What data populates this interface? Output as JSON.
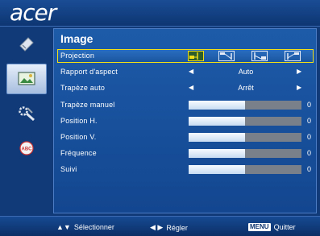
{
  "brand": "acer",
  "sidebar": [
    {
      "name": "color-tool-icon",
      "active": false
    },
    {
      "name": "image-icon",
      "active": true
    },
    {
      "name": "settings-icon",
      "active": false
    },
    {
      "name": "language-icon",
      "active": false,
      "text": "ABC"
    }
  ],
  "panel": {
    "title": "Image",
    "rows": [
      {
        "label": "Projection",
        "kind": "icons",
        "selected": true
      },
      {
        "label": "Rapport d'aspect",
        "kind": "choice",
        "value": "Auto"
      },
      {
        "label": "Trapèze auto",
        "kind": "choice",
        "value": "Arrêt"
      },
      {
        "label": "Trapèze manuel",
        "kind": "slider",
        "value": "0",
        "level": 0.5
      },
      {
        "label": "Position H.",
        "kind": "slider",
        "value": "0",
        "level": 0.5
      },
      {
        "label": "Position V.",
        "kind": "slider",
        "value": "0",
        "level": 0.5
      },
      {
        "label": "Fréquence",
        "kind": "slider",
        "value": "0",
        "level": 0.5
      },
      {
        "label": "Suivi",
        "kind": "slider",
        "value": "0",
        "level": 0.5
      }
    ]
  },
  "footer": {
    "select_label": "Sélectionner",
    "adjust_label": "Régler",
    "menu_key": "MENU",
    "quit_label": "Quitter"
  },
  "colors": {
    "accent": "#f2df18",
    "background": "#113a78"
  }
}
